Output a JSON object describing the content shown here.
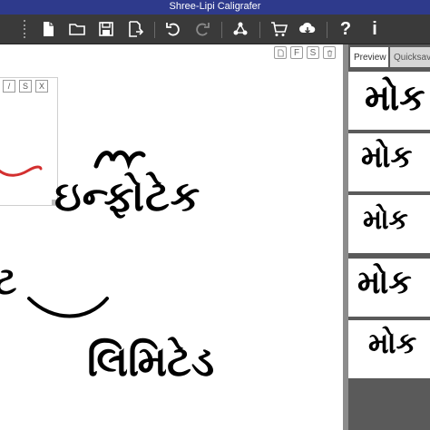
{
  "window": {
    "title": "Shree-Lipi Caligrafer"
  },
  "toolbar": {
    "buttons": [
      {
        "name": "new-file",
        "icon": "new-file-icon"
      },
      {
        "name": "open-folder",
        "icon": "folder-open-icon"
      },
      {
        "name": "save",
        "icon": "floppy-save-icon"
      },
      {
        "name": "export",
        "icon": "export-icon"
      },
      {
        "name": "undo",
        "icon": "undo-icon"
      },
      {
        "name": "redo",
        "icon": "redo-icon"
      },
      {
        "name": "share",
        "icon": "share-icon"
      },
      {
        "name": "cart",
        "icon": "cart-icon"
      },
      {
        "name": "cloud-download",
        "icon": "cloud-download-icon"
      },
      {
        "name": "help",
        "icon": "help-icon",
        "label": "?"
      },
      {
        "name": "info",
        "icon": "info-icon",
        "label": "i"
      }
    ]
  },
  "canvas": {
    "icons": [
      {
        "name": "page",
        "label": ""
      },
      {
        "name": "fill",
        "label": "F"
      },
      {
        "name": "style",
        "label": "S"
      },
      {
        "name": "delete",
        "label": ""
      }
    ],
    "panel_buttons": [
      "/",
      "S",
      "X"
    ],
    "stroke_color": "#d32f2f",
    "texts": {
      "line1": "ઇન્ફોટેક",
      "line2": "ટ",
      "line3": "લિમિટેડ"
    }
  },
  "right_panel": {
    "tabs": [
      "Preview",
      "Quicksave"
    ],
    "previews": [
      "મોક",
      "મોક",
      "મોક",
      "મોક",
      "મોક"
    ]
  }
}
